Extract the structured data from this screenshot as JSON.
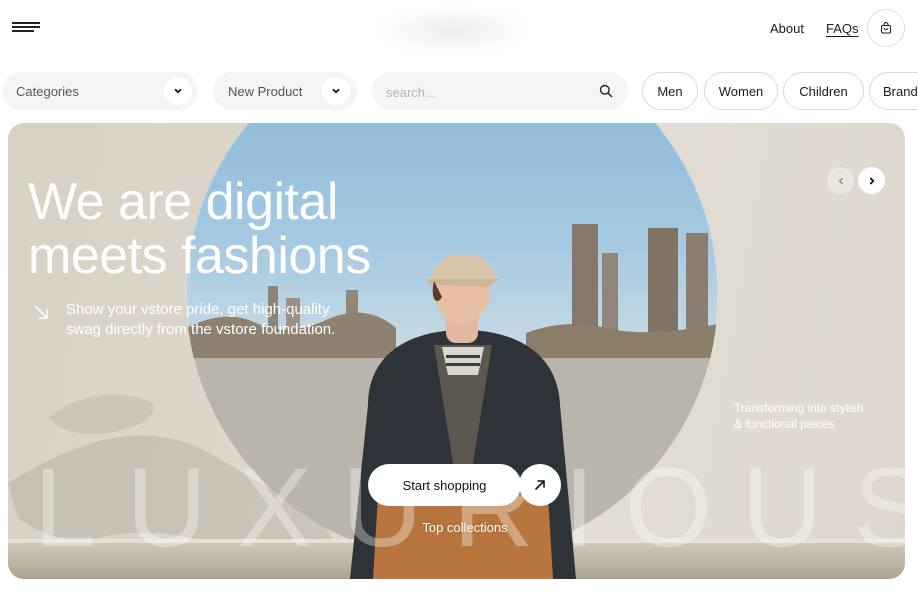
{
  "header": {
    "menu_icon": "hamburger-menu-icon",
    "nav": [
      {
        "label": "About"
      },
      {
        "label": "FAQs"
      }
    ],
    "cart_icon": "shopping-bag-icon"
  },
  "filters": {
    "categories": {
      "label": "Categories",
      "icon": "chevron-down-icon"
    },
    "new_product": {
      "label": "New Product",
      "icon": "chevron-down-icon"
    },
    "search": {
      "placeholder": "search...",
      "icon": "search-icon"
    }
  },
  "chips": [
    {
      "label": "Men"
    },
    {
      "label": "Women"
    },
    {
      "label": "Children"
    },
    {
      "label": "Brand"
    }
  ],
  "hero": {
    "title_line1": "We are digital",
    "title_line2": "meets fashions",
    "subtitle_line1": "Show your vstore pride, get high-quality",
    "subtitle_line2": "swag directly from the vstore foundation.",
    "side_text_line1": "Transforming into stylish",
    "side_text_line2": "& functional pieces",
    "watermark": "LUXURIOUS",
    "cta_label": "Start shopping",
    "cta_icon": "arrow-up-right-icon",
    "secondary_link": "Top collections",
    "carousel": {
      "prev_icon": "chevron-left-icon",
      "next_icon": "chevron-right-icon"
    }
  },
  "colors": {
    "accent": "#1a1a1a",
    "surface": "#f5f5f5",
    "hero_bg": "#ddd6ca",
    "sky": "#8fbad9"
  }
}
